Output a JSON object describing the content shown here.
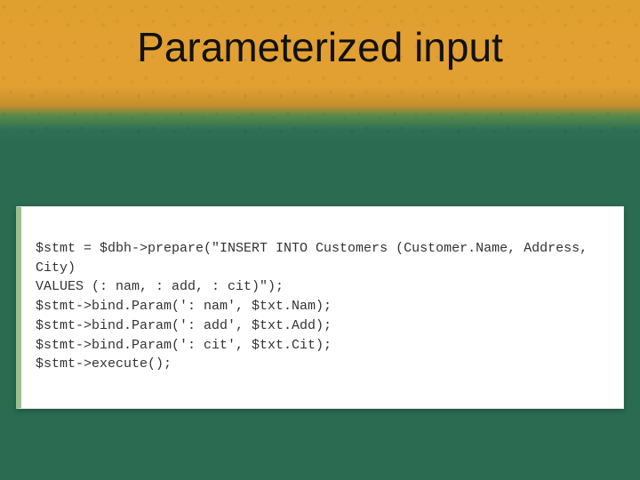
{
  "slide": {
    "title": "Parameterized input",
    "code_lines": [
      "$stmt = $dbh->prepare(\"INSERT INTO Customers (Customer.Name, Address, City)",
      "VALUES (: nam, : add, : cit)\");",
      "$stmt->bind.Param(': nam', $txt.Nam);",
      "$stmt->bind.Param(': add', $txt.Add);",
      "$stmt->bind.Param(': cit', $txt.Cit);",
      "$stmt->execute();"
    ]
  },
  "colors": {
    "header_gradient_top": "#e0a030",
    "header_gradient_bottom": "#2a6b52",
    "card_accent": "#9bbf8f"
  }
}
